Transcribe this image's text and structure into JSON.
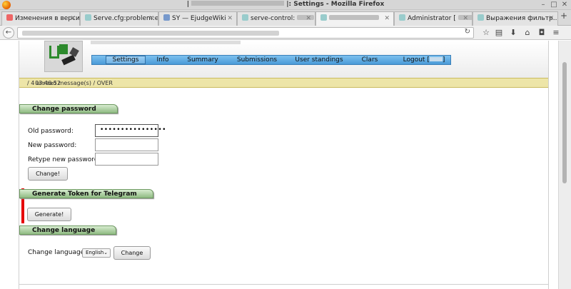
{
  "window": {
    "title_prefix": "|",
    "title_suffix": "|: Settings - Mozilla Firefox"
  },
  "tabs": [
    {
      "label": "Изменения в верси...",
      "active": false
    },
    {
      "label": "Serve.cfg:problem:e...",
      "active": false
    },
    {
      "label": "SY — EjudgeWiki",
      "active": false
    },
    {
      "label": "serve-control:",
      "active": false
    },
    {
      "label": "",
      "active": true
    },
    {
      "label": "Administrator [",
      "active": false
    },
    {
      "label": "Выражения фильтр...",
      "active": false
    }
  ],
  "icons": {
    "back": "back-arrow-icon",
    "reload": "reload-icon",
    "star": "star-icon",
    "reader": "reading-list-icon",
    "download": "download-icon",
    "home": "home-icon",
    "pocket": "pocket-icon",
    "menu": "hamburger-menu-icon"
  },
  "menu": {
    "settings": "Settings",
    "info": "Info",
    "summary": "Summary",
    "submissions": "Submissions",
    "standings": "User standings",
    "clars": "Clars",
    "logout": "Logout ["
  },
  "status": {
    "time": "03:46:52",
    "messages": "/ 4 unread message(s) / OVER"
  },
  "change_password": {
    "header": "Change password",
    "old_label": "Old password:",
    "old_value": "••••••••••••••••",
    "new_label": "New password:",
    "new_value": "",
    "retype_label": "Retype new password:",
    "retype_value": "",
    "button": "Change!"
  },
  "telegram": {
    "header": "Generate Token for Telegram",
    "button": "Generate!"
  },
  "language": {
    "header": "Change language",
    "label": "Change language",
    "selected": "English",
    "button": "Change"
  },
  "colors": {
    "menu_blue": "#4a9ad8",
    "section_green": "#8fbb82",
    "status_yellow": "#ede5a8",
    "highlight_red": "#e60000"
  }
}
